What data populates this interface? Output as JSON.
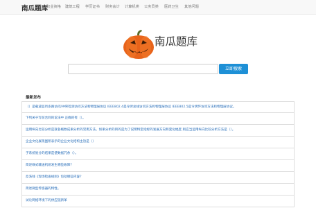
{
  "header": {
    "brand": "南瓜题库",
    "nav": [
      "职业资格",
      "建筑工程",
      "学历证书",
      "财务会计",
      "计算机类",
      "公务员类",
      "医药卫生",
      "其他问题"
    ]
  },
  "logo": {
    "title": "南瓜题库",
    "icon": "pumpkin-icon"
  },
  "search": {
    "placeholder": "",
    "button_label": "立即搜索"
  },
  "latest": {
    "heading": "最新发布",
    "items": [
      "（）是载波监听多路访问/冲突检测访问方法和物理层协议 IEEE802.4是令牌总线访问方法和物理层协议 IEEE802.5是令牌环访问方法和物理层协议。",
      "下列关于写前合同的说法中 正确的有（）。",
      "运用纵向比较分析是就各概数成果分析的常用方法。如果分析的目的是为了说明特定指标的发展方向和变化幅度 则应当运用纵向比较分析方法是（）。",
      "企业文化展现图所表示的企业文化结构主旨是（）",
      "子系统划分的结果是使数据冗余（）。",
      "简述罪式输送机易发生哪些故障？",
      "反洗钱《现场检查规则》包括哪些内容？",
      "简述微型传感器的特性。",
      "试论网络环境下的供应链新革"
    ]
  },
  "colors": {
    "accent": "#1e90d6",
    "link": "#2a6fba",
    "navbar_bg": "#f8f8f8"
  }
}
